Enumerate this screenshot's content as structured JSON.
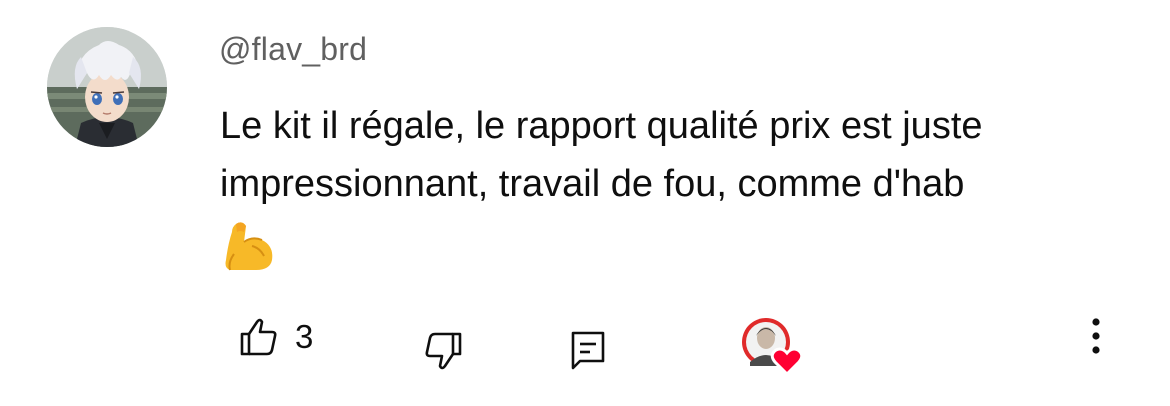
{
  "comment": {
    "author": "@flav_brd",
    "text": "Le kit il régale, le rapport qualité prix est juste impressionnant, travail de fou, comme d'hab",
    "emoji_icon": "flexed-biceps-emoji",
    "avatar_icon": "anime-avatar-image"
  },
  "actions": {
    "like_icon": "thumbs-up-icon",
    "like_count": "3",
    "dislike_icon": "thumbs-down-icon",
    "reply_icon": "reply-comment-icon",
    "creator_heart_icon": "creator-heart-icon",
    "more_icon": "more-vertical-icon"
  },
  "colors": {
    "text_primary": "#0f0f0f",
    "text_secondary": "#606060",
    "heart_red": "#ff0033",
    "emoji_yellow": "#f7b928"
  }
}
